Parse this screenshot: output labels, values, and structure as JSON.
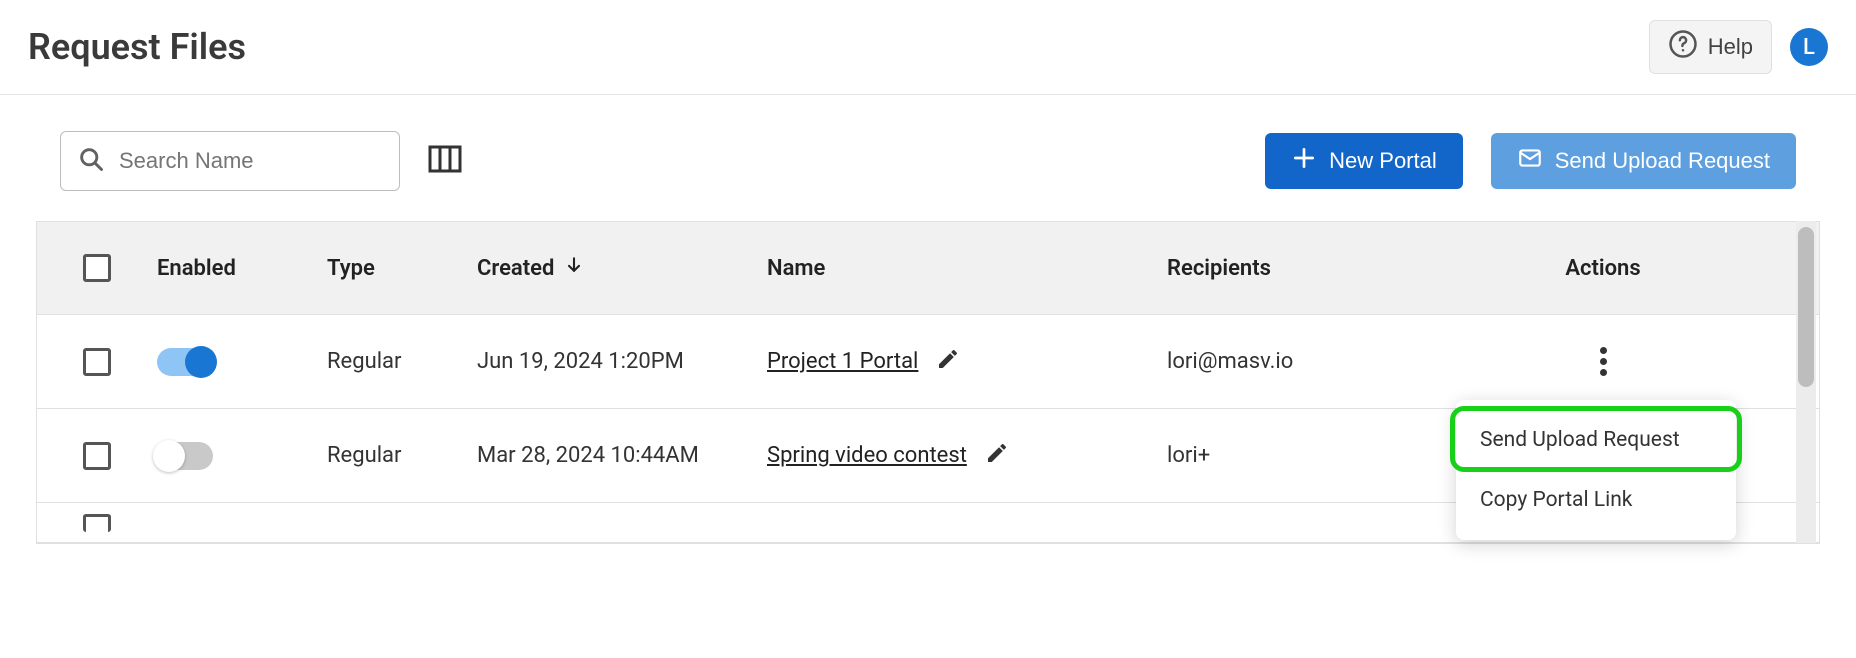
{
  "header": {
    "title": "Request Files",
    "help_label": "Help",
    "avatar_initial": "L"
  },
  "toolbar": {
    "search_placeholder": "Search Name",
    "new_portal_label": "New Portal",
    "send_upload_label": "Send Upload Request"
  },
  "columns": {
    "enabled": "Enabled",
    "type": "Type",
    "created": "Created",
    "name": "Name",
    "recipients": "Recipients",
    "actions": "Actions"
  },
  "rows": [
    {
      "enabled": true,
      "type": "Regular",
      "created": "Jun 19, 2024 1:20PM",
      "name": "Project 1 Portal",
      "recipients": "lori@masv.io"
    },
    {
      "enabled": false,
      "type": "Regular",
      "created": "Mar 28, 2024 10:44AM",
      "name": "Spring video contest",
      "recipients": "lori+"
    }
  ],
  "actions_menu": {
    "send_upload_request": "Send Upload Request",
    "copy_portal_link": "Copy Portal Link"
  }
}
